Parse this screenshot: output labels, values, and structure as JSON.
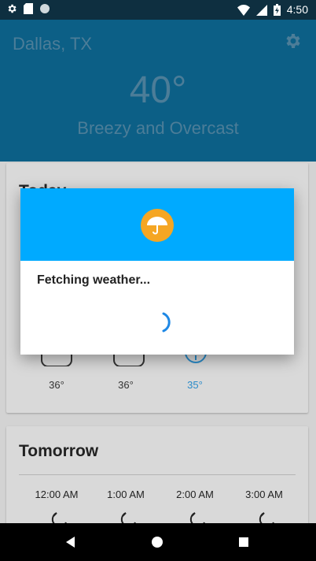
{
  "status_bar": {
    "time": "4:50",
    "left_icons": [
      "gear-icon",
      "sd-card-icon",
      "circle-icon"
    ],
    "right_icons": [
      "wifi-icon",
      "signal-icon",
      "battery-charging-icon"
    ]
  },
  "header": {
    "city": "Dallas, TX",
    "temperature": "40°",
    "condition": "Breezy and Overcast"
  },
  "today_card": {
    "title": "Today",
    "temps": [
      "36°",
      "36°",
      "35°"
    ],
    "highlight_color": "#2a8bc9"
  },
  "tomorrow_card": {
    "title": "Tomorrow",
    "hours": [
      "12:00 AM",
      "1:00 AM",
      "2:00 AM",
      "3:00 AM"
    ],
    "icon": "moon-icon"
  },
  "dialog": {
    "message": "Fetching weather...",
    "header_color": "#00aaff",
    "icon": "umbrella-icon"
  },
  "nav_bar": {
    "buttons": [
      "back-icon",
      "home-icon",
      "recents-icon"
    ]
  }
}
